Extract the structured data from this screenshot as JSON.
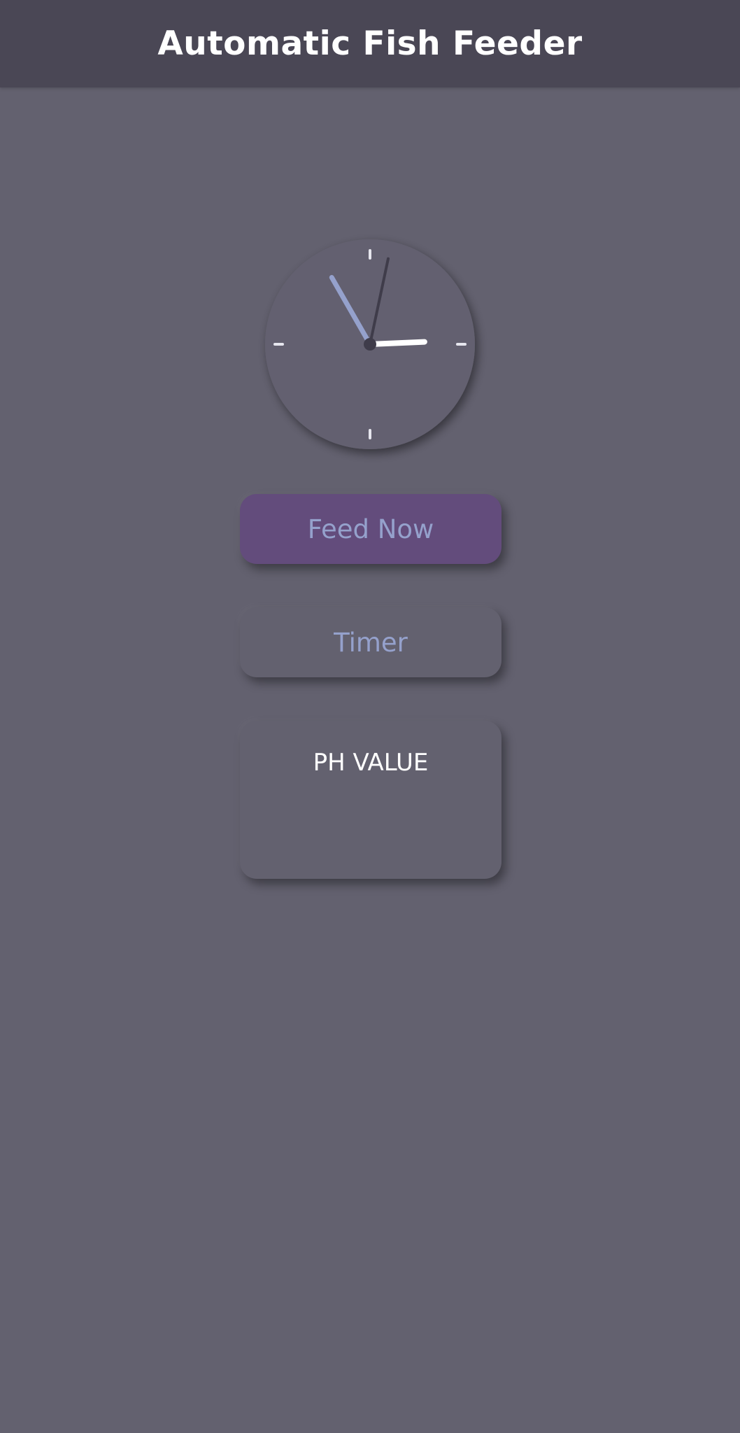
{
  "app_bar": {
    "title": "Automatic Fish Feeder"
  },
  "clock": {
    "time": {
      "hour": 2,
      "minute": 55,
      "second": 2
    },
    "colors": {
      "face": "#63616f",
      "ticks": "#e6e6ee",
      "hour_hand": "#ffffff",
      "minute_hand": "#95a1cc",
      "second_hand": "#3f3c4a",
      "center": "#3f3c4a"
    }
  },
  "buttons": {
    "feed_now": "Feed Now",
    "timer": "Timer"
  },
  "ph_card": {
    "label": "PH VALUE",
    "value": ""
  },
  "colors": {
    "background": "#63616f",
    "app_bar": "#4a4755",
    "feed_button": "#634c7c",
    "button_text": "#95a1cc"
  },
  "icons": [
    "analog-clock-icon"
  ]
}
